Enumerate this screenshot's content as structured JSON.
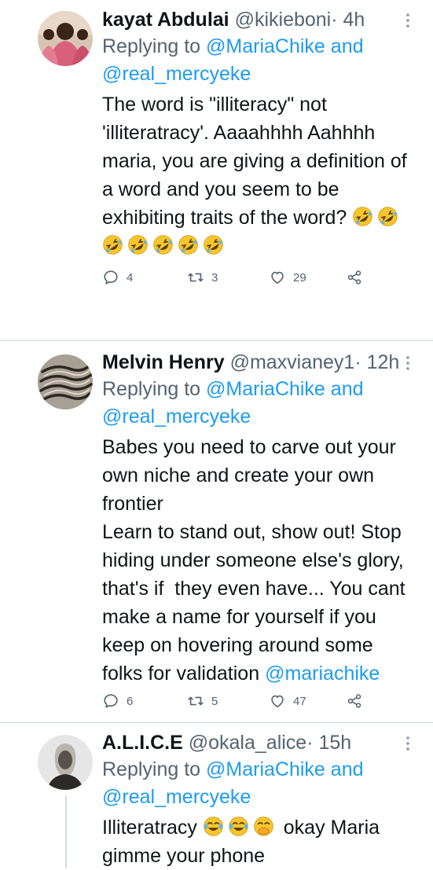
{
  "tweets": [
    {
      "name": "kayat Abdulai",
      "handle": "@kikieboni",
      "dot": "·",
      "time": "4h",
      "replying_prefix": "Replying to",
      "replying_user1": "@MariaChike",
      "replying_and": "and",
      "replying_user2": "@real_mercyeke",
      "text": "The word is \"illiteracy\" not\n'illiteratracy'. Aaaahhhh Aahhhh\nmaria, you are giving a definition of\na word and you seem to be\nexhibiting traits of the word?",
      "emoji_rolling": "🤣",
      "replies": "4",
      "retweets": "3",
      "likes": "29"
    },
    {
      "name": "Melvin Henry",
      "handle": "@maxvianey1",
      "dot": "·",
      "time": "12h",
      "replying_prefix": "Replying to",
      "replying_user1": "@MariaChike",
      "replying_and": "and",
      "replying_user2": "@real_mercyeke",
      "text": "Babes you need to carve out your\nown niche and create your own\nfrontier\nLearn to stand out, show out! Stop\nhiding under someone else's glory,\nthat's if  they even have... You cant\nmake a name for yourself if you\nkeep on hovering around some\nfolks for validation",
      "text_mention": "@mariachike",
      "replies": "6",
      "retweets": "5",
      "likes": "47"
    },
    {
      "name": "A.L.I.C.E",
      "handle": "@okala_alice",
      "dot": "·",
      "time": "15h",
      "replying_prefix": "Replying to",
      "replying_user1": "@MariaChike",
      "replying_and": "and",
      "replying_user2": "@real_mercyeke",
      "text_line1": "Illiteratracy",
      "emoji_joy": "😂",
      "emoji_hand_over_mouth": "🤭",
      "text_after_emoji": "okay Maria",
      "text_line2": "gimme your phone"
    }
  ],
  "colors": {
    "text": "#0f1419",
    "muted": "#536471",
    "link": "#1d9bf0",
    "divider": "#cfd9de",
    "emoji_face": "#f7c52e"
  },
  "icons": [
    "more-icon",
    "reply-icon",
    "retweet-icon",
    "like-icon",
    "share-icon"
  ]
}
